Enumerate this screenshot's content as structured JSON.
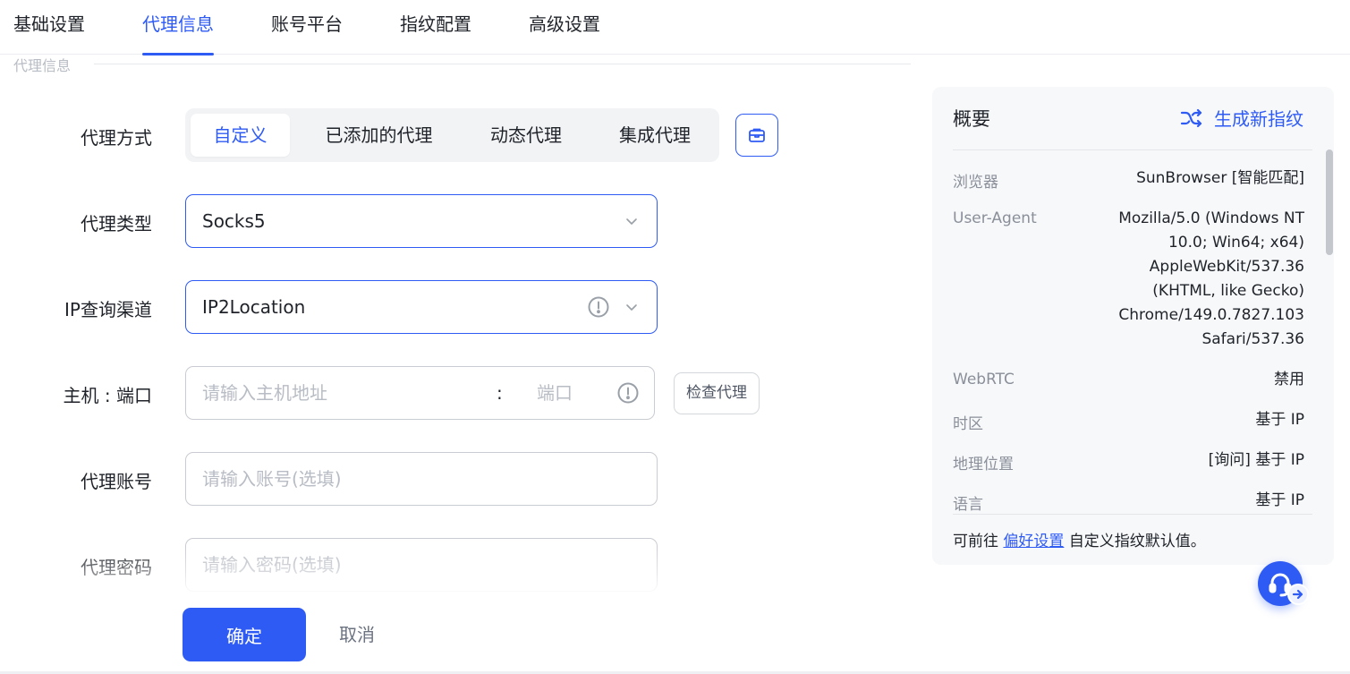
{
  "tabs": [
    {
      "label": "基础设置",
      "active": false
    },
    {
      "label": "代理信息",
      "active": true
    },
    {
      "label": "账号平台",
      "active": false
    },
    {
      "label": "指纹配置",
      "active": false
    },
    {
      "label": "高级设置",
      "active": false
    }
  ],
  "section": {
    "label": "代理信息"
  },
  "form": {
    "proxy_mode": {
      "label": "代理方式",
      "options": [
        "自定义",
        "已添加的代理",
        "动态代理",
        "集成代理"
      ],
      "selected": "自定义"
    },
    "proxy_type": {
      "label": "代理类型",
      "value": "Socks5"
    },
    "ip_channel": {
      "label": "IP查询渠道",
      "value": "IP2Location"
    },
    "host_port": {
      "label": "主机 : 端口",
      "host_placeholder": "请输入主机地址",
      "separator": ":",
      "port_placeholder": "端口",
      "check_label": "检查代理"
    },
    "account": {
      "label": "代理账号",
      "placeholder": "请输入账号(选填)"
    },
    "password": {
      "label": "代理密码",
      "placeholder": "请输入密码(选填)"
    }
  },
  "footer": {
    "ok_label": "确定",
    "cancel_label": "取消"
  },
  "summary": {
    "title": "概要",
    "action_label": "生成新指纹",
    "items": [
      {
        "key": "浏览器",
        "value": "SunBrowser [智能匹配]"
      },
      {
        "key": "User-Agent",
        "value_lines": [
          "Mozilla/5.0 (Windows NT",
          "10.0; Win64; x64)",
          "AppleWebKit/537.36",
          "(KHTML, like Gecko)",
          "Chrome/149.0.7827.103",
          "Safari/537.36"
        ]
      },
      {
        "key": "WebRTC",
        "value": "禁用"
      },
      {
        "key": "时区",
        "value": "基于 IP"
      },
      {
        "key": "地理位置",
        "value": "[询问] 基于 IP"
      },
      {
        "key": "语言",
        "value": "基于 IP"
      }
    ],
    "note_prefix": "可前往",
    "note_link": "偏好设置",
    "note_suffix": "自定义指纹默认值。"
  },
  "colors": {
    "accent": "#2f5bf5",
    "muted": "#8a8f99",
    "panel_bg": "#f7f8fa"
  },
  "icons": {
    "proxy_bag": "briefcase-icon",
    "dropdown": "chevron-down-icon",
    "warning": "exclamation-circle-icon",
    "shuffle": "shuffle-icon",
    "support": "headset-icon"
  }
}
